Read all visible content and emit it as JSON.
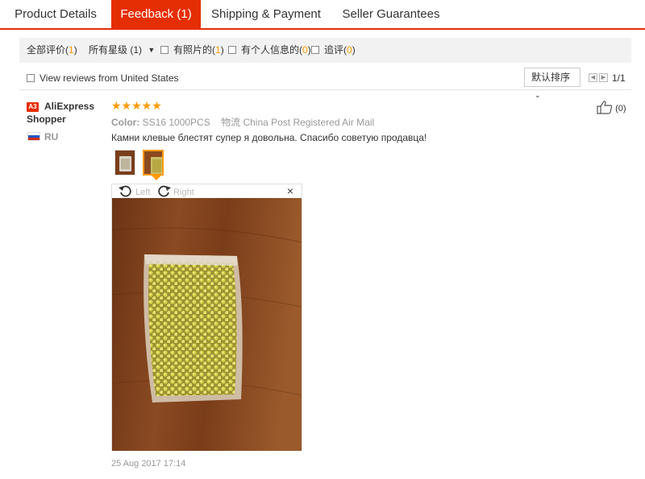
{
  "tabs": [
    {
      "label": "Product Details"
    },
    {
      "label": "Feedback (1)"
    },
    {
      "label": "Shipping & Payment"
    },
    {
      "label": "Seller Guarantees"
    }
  ],
  "filters": {
    "all_reviews": {
      "label": "全部评价",
      "count": "1"
    },
    "all_stars": {
      "label": "所有星级",
      "count_text": "(1)"
    },
    "with_photos": {
      "label": "有照片的",
      "count": "1"
    },
    "with_personal_info": {
      "label": "有个人信息的",
      "count": "0"
    },
    "additional_review": {
      "label": "追评",
      "count": "0"
    }
  },
  "row2": {
    "us_filter_label": "View reviews from United States",
    "sort_label": "默认排序",
    "page_info": "1/1"
  },
  "review": {
    "user_badge": "A3",
    "user_name": "AliExpress Shopper",
    "country": "RU",
    "stars": "★★★★★",
    "rating": 5,
    "color_label": "Color:",
    "color_value": "SS16 1000PCS",
    "logistics_label": "物流",
    "logistics_value": "China Post Registered Air Mail",
    "text": "Камни клевые блестят супер я довольна. Спасибо советую продавца!",
    "viewer": {
      "rotate_left": "Left",
      "rotate_right": "Right",
      "close": "×"
    },
    "likes": "(0)",
    "date": "25 Aug 2017 17:14"
  },
  "colors": {
    "accent": "#e62e04",
    "star": "#ff9900",
    "count": "#ff9900"
  }
}
